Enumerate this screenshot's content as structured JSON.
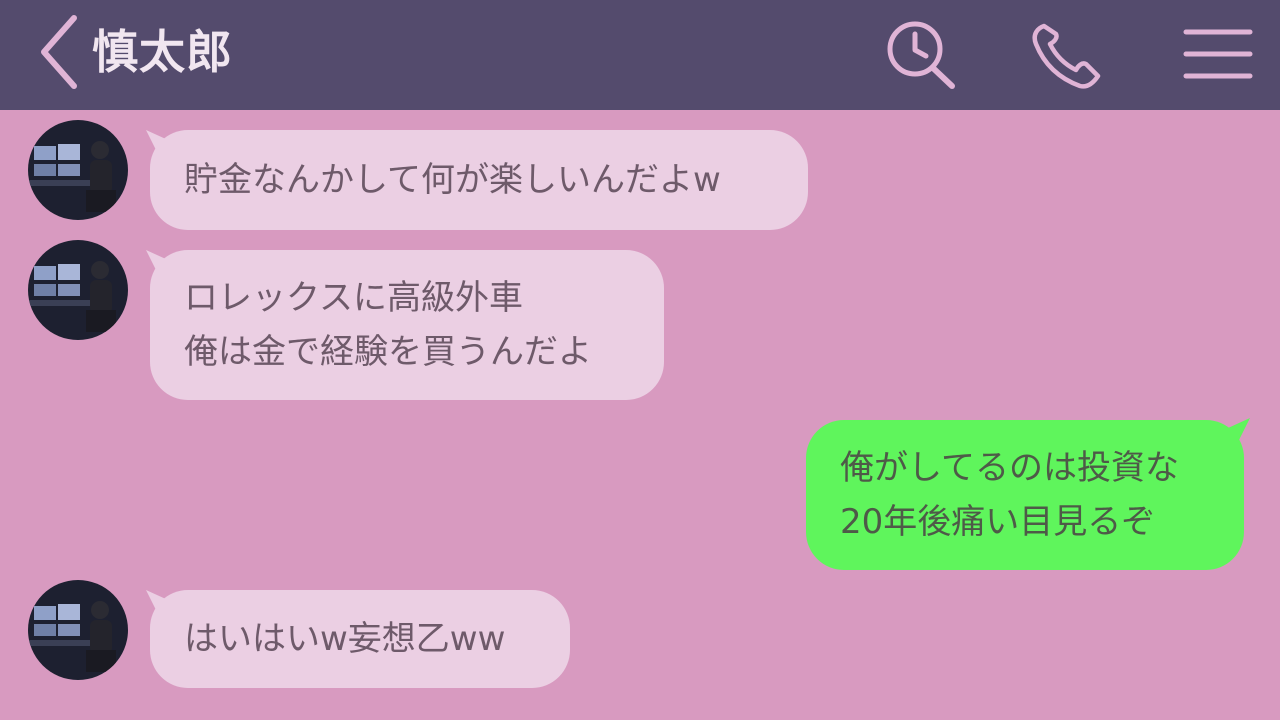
{
  "header": {
    "title": "慎太郎",
    "back_icon": "chevron-left-icon",
    "search_icon": "search-history-icon",
    "call_icon": "phone-icon",
    "menu_icon": "hamburger-menu-icon"
  },
  "colors": {
    "header_bg": "#544b6d",
    "chat_bg": "#d89ac0",
    "incoming_bubble": "#ebcfe3",
    "outgoing_bubble": "#5ff55c",
    "icon_color": "#e0b4d6"
  },
  "messages": [
    {
      "direction": "incoming",
      "lines": [
        "貯金なんかして何が楽しいんだよw"
      ]
    },
    {
      "direction": "incoming",
      "lines": [
        "ロレックスに高級外車",
        "俺は金で経験を買うんだよ"
      ]
    },
    {
      "direction": "outgoing",
      "lines": [
        "俺がしてるのは投資な",
        "20年後痛い目見るぞ"
      ]
    },
    {
      "direction": "incoming",
      "lines": [
        "はいはいw妄想乙ww"
      ]
    }
  ]
}
